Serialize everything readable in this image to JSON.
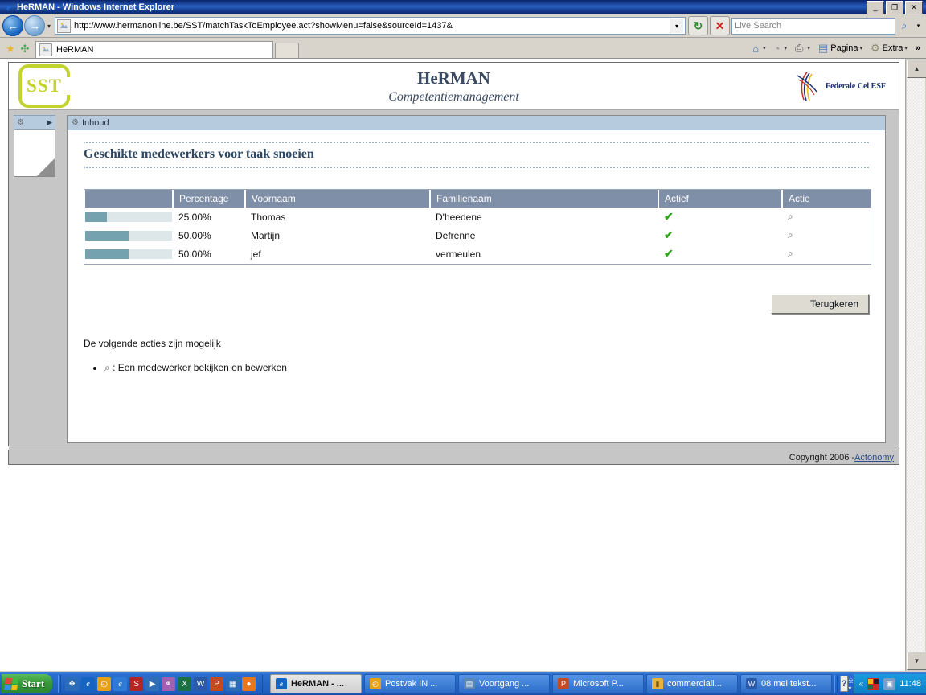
{
  "window": {
    "title": "HeRMAN - Windows Internet Explorer",
    "icon": "ie-icon",
    "minimize_label": "_",
    "restore_label": "❐",
    "close_label": "✕"
  },
  "navigation": {
    "back_icon": "←",
    "forward_icon": "→",
    "history_caret": "▾",
    "url": "http://www.hermanonline.be/SST/matchTaskToEmployee.act?showMenu=false&sourceId=1437&",
    "url_dropdown_icon": "▾",
    "refresh_icon": "↻",
    "stop_icon": "✕",
    "search_placeholder": "Live Search",
    "search_value": "",
    "search_icon": "⌕",
    "search_caret": "▾"
  },
  "tabs": {
    "favorites_icon": "★",
    "add_favorites_icon": "✣",
    "items": [
      {
        "label": "HeRMAN",
        "favicon": "site-icon",
        "active": true
      }
    ],
    "new_tab_label": ""
  },
  "command_bar": {
    "items": [
      {
        "icon": "home-icon",
        "glyph": "⌂",
        "label": "",
        "caret": "▾"
      },
      {
        "icon": "rss-icon",
        "glyph": "◔",
        "label": "",
        "caret": "▾"
      },
      {
        "icon": "print-icon",
        "glyph": "⎙",
        "label": "",
        "caret": "▾"
      },
      {
        "icon": "page-icon",
        "glyph": "▤",
        "label": "Pagina",
        "caret": "▾"
      },
      {
        "icon": "tools-icon",
        "glyph": "⚙",
        "label": "Extra",
        "caret": "▾"
      }
    ],
    "overflow": "»"
  },
  "brand": {
    "logo_text": "SST",
    "title": "HeRMAN",
    "subtitle": "Competentiemanagement",
    "esf_label": "Federale Cel ESF"
  },
  "side_panel": {
    "gear_icon": "⚙",
    "expand_icon": "▶"
  },
  "content": {
    "panel_header": "Inhoud",
    "panel_header_icon": "⚙",
    "section_title": "Geschikte medewerkers voor taak snoeien",
    "table": {
      "columns": [
        "",
        "Percentage",
        "Voornaam",
        "Familienaam",
        "Actief",
        "Actie"
      ],
      "rows": [
        {
          "percent": 25.0,
          "percent_label": "25.00%",
          "voornaam": "Thomas",
          "familienaam": "D'heedene",
          "actief": "✔",
          "actie": "⌕"
        },
        {
          "percent": 50.0,
          "percent_label": "50.00%",
          "voornaam": "Martijn",
          "familienaam": "Defrenne",
          "actief": "✔",
          "actie": "⌕"
        },
        {
          "percent": 50.0,
          "percent_label": "50.00%",
          "voornaam": "jef",
          "familienaam": "vermeulen",
          "actief": "✔",
          "actie": "⌕"
        }
      ]
    },
    "back_button": "Terugkeren",
    "actions_intro": "De volgende acties zijn mogelijk",
    "actions": [
      {
        "icon": "⌕",
        "text": ": Een medewerker bekijken en bewerken"
      }
    ]
  },
  "footer": {
    "copyright": "Copyright 2006 - ",
    "link": "Actonomy"
  },
  "scrollbar": {
    "up_icon": "▲",
    "down_icon": "▼"
  },
  "taskbar": {
    "start_label": "Start",
    "quick_launch": [
      {
        "name": "show-desktop-icon",
        "glyph": "❖",
        "color": "#2b6cb8"
      },
      {
        "name": "internet-explorer-icon",
        "glyph": "e",
        "color": "#1565c0"
      },
      {
        "name": "clock-icon",
        "glyph": "◴",
        "color": "#e8a117"
      },
      {
        "name": "browser-icon",
        "glyph": "e",
        "color": "#2e7bd6"
      },
      {
        "name": "sst-app-icon",
        "glyph": "S",
        "color": "#b32626"
      },
      {
        "name": "media-player-icon",
        "glyph": "▶",
        "color": "#2f6fb5"
      },
      {
        "name": "key-icon",
        "glyph": "⚷",
        "color": "#a05fb0"
      },
      {
        "name": "excel-icon",
        "glyph": "X",
        "color": "#1d7044"
      },
      {
        "name": "word-icon",
        "glyph": "W",
        "color": "#2b5ba8"
      },
      {
        "name": "powerpoint-icon",
        "glyph": "P",
        "color": "#c44a22"
      },
      {
        "name": "outlook-icon",
        "glyph": "▦",
        "color": "#2b6cb8"
      },
      {
        "name": "firefox-icon",
        "glyph": "●",
        "color": "#e8761b"
      }
    ],
    "tasks": [
      {
        "label": "HeRMAN - ...",
        "icon": "ie-icon",
        "glyph": "e",
        "color": "#1565c0",
        "active": true
      },
      {
        "label": "Postvak IN ...",
        "icon": "outlook-icon",
        "glyph": "◴",
        "color": "#e8a117",
        "active": false
      },
      {
        "label": "Voortgang ...",
        "icon": "document-icon",
        "glyph": "▤",
        "color": "#5b86b5",
        "active": false
      },
      {
        "label": "Microsoft P...",
        "icon": "powerpoint-icon",
        "glyph": "P",
        "color": "#c44a22",
        "active": false
      },
      {
        "label": "commerciali...",
        "icon": "folder-icon",
        "glyph": "▰",
        "color": "#e8b23b",
        "active": false
      },
      {
        "label": "08 mei tekst...",
        "icon": "word-icon",
        "glyph": "W",
        "color": "#2b5ba8",
        "active": false
      }
    ],
    "tray": {
      "help_icon": "?",
      "expand_icon": "«",
      "icons": [
        {
          "name": "language-bar-icon",
          "glyph": "▦",
          "color": "#cf2a2a"
        },
        {
          "name": "network-icon",
          "glyph": "▣",
          "color": "#7a9ec8"
        }
      ],
      "clock": "11:48"
    }
  }
}
